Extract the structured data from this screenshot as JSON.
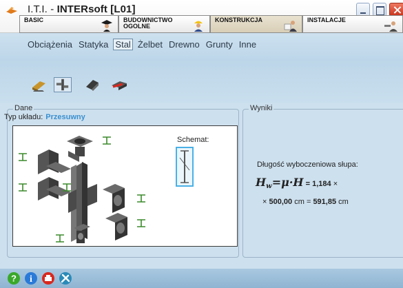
{
  "window": {
    "icon": "iti-logo-icon",
    "title_prefix": "I.T.I. - ",
    "title_main": "INTERsoft [L01]"
  },
  "module_tabs": [
    {
      "label": "BASIC",
      "icon": "graduate-icon"
    },
    {
      "label": "BUDOWNICTWO\nOGOLNE",
      "icon": "builder-icon"
    },
    {
      "label": "KONSTRUKCJA",
      "icon": "engineer-icon",
      "active": true
    },
    {
      "label": "INSTALACJE",
      "icon": "plumber-icon"
    }
  ],
  "menu": {
    "items": [
      "Obciążenia",
      "Statyka",
      "Stal",
      "Żelbet",
      "Drewno",
      "Grunty",
      "Inne"
    ],
    "selected": "Stal"
  },
  "tools": [
    {
      "icon": "beam-icon"
    },
    {
      "icon": "column-connection-icon",
      "selected": true
    },
    {
      "icon": "roof-truss-icon"
    },
    {
      "icon": "red-connection-icon"
    }
  ],
  "dane": {
    "title": "Dane",
    "typ_label": "Typ układu:",
    "typ_value": "Przesuwny",
    "schemat_label": "Schemat:"
  },
  "wyniki": {
    "title": "Wyniki",
    "description": "Długość wyboczeniowa słupa:",
    "formula_lhs": "H",
    "formula_sub": "w",
    "formula_rhs": "=μ·H",
    "formula_value": "= 1,184",
    "formula_times": "×",
    "result_times": "×",
    "result_length": "500,00",
    "result_unit_equals": "cm =",
    "result_value": "591,85",
    "result_unit": "cm"
  },
  "bottom_icons": [
    "help-icon",
    "info-icon",
    "print-icon",
    "tools-icon"
  ],
  "colors": {
    "accent": "#3b8fcf",
    "panel_bg": "#cde0ee",
    "close_red": "#c8331d",
    "profile_green": "#3a8a2a"
  }
}
